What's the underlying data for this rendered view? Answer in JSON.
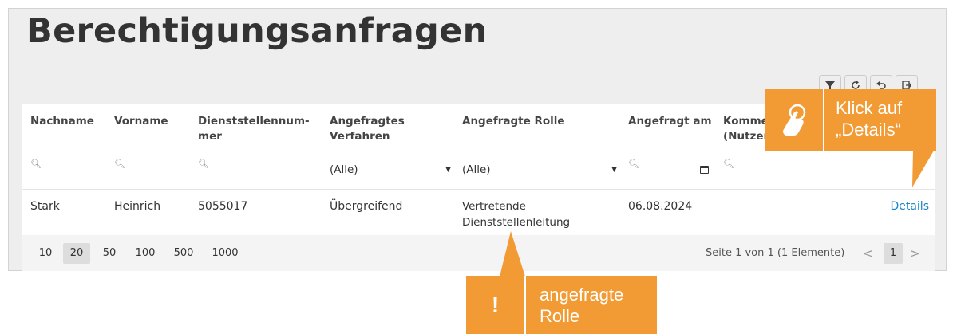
{
  "page": {
    "title": "Berechtigungsanfragen"
  },
  "toolbar": {
    "icons": [
      "filter-icon",
      "refresh-icon",
      "undo-icon",
      "export-icon"
    ]
  },
  "grid": {
    "columns": [
      "Nachname",
      "Vorname",
      "Dienststellennum-\nmer",
      "Angefragtes\nVerfahren",
      "Angefragte Rolle",
      "Angefragt am",
      "Komme\n(Nutzer"
    ],
    "filters": {
      "verfahren_selected": "(Alle)",
      "rolle_selected": "(Alle)"
    },
    "rows": [
      {
        "nachname": "Stark",
        "vorname": "Heinrich",
        "dienststellennummer": "5055017",
        "verfahren": "Übergreifend",
        "rolle": "Vertretende\nDienststellenleitung",
        "angefragt_am": "06.08.2024",
        "kommentar": "",
        "action": "Details"
      }
    ]
  },
  "pager": {
    "page_sizes": [
      "10",
      "20",
      "50",
      "100",
      "500",
      "1000"
    ],
    "active_page_size": "20",
    "info": "Seite 1 von 1 (1 Elemente)",
    "prev": "<",
    "current_page": "1",
    "next": ">"
  },
  "callouts": {
    "details": {
      "text": "Klick auf\n„Details“",
      "icon": "hand-pointer-icon"
    },
    "rolle": {
      "text": "angefragte\nRolle",
      "icon_text": "!"
    }
  },
  "colors": {
    "callout": "#f29a33",
    "link": "#1a87c9",
    "panel_bg": "#eeeeee"
  }
}
